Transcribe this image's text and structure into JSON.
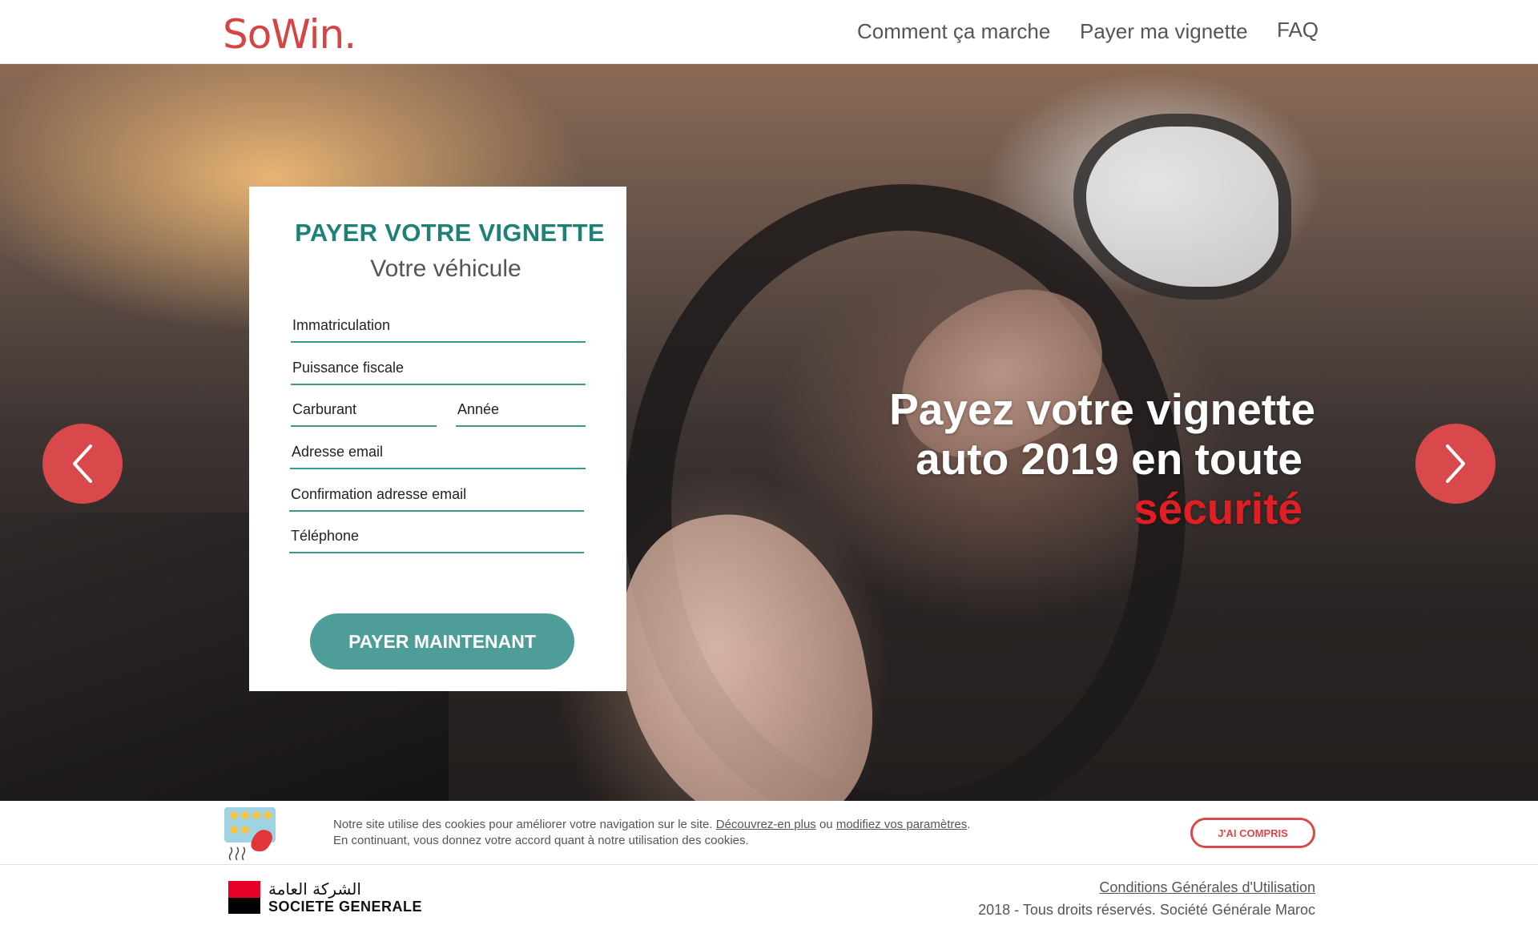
{
  "brand": {
    "logo": "SoWin."
  },
  "nav": {
    "items": [
      "Comment ça marche",
      "Payer ma vignette",
      "FAQ"
    ]
  },
  "form": {
    "title": "PAYER VOTRE VIGNETTE",
    "subtitle": "Votre véhicule",
    "fields": {
      "immatriculation": "Immatriculation",
      "puissance": "Puissance fiscale",
      "carburant": "Carburant",
      "annee": "Année",
      "email": "Adresse email",
      "email_confirm": "Confirmation adresse email",
      "telephone": "Téléphone"
    },
    "submit_label": "PAYER MAINTENANT"
  },
  "hero": {
    "line1": "Payez votre vignette",
    "line2": "auto 2019 en toute",
    "highlight": "sécurité"
  },
  "cookie": {
    "text_start": "Notre site utilise des cookies pour améliorer votre navigation sur le site.",
    "link_more": "Découvrez-en plus",
    "text_or": "ou",
    "link_settings": "modifiez vos paramètres",
    "text_period": ".",
    "line2": "En continuant, vous donnez votre accord quant à notre utilisation des cookies.",
    "accept_label": "J'AI COMPRIS"
  },
  "footer": {
    "company_arabic": "الشركة العامة",
    "company_name": "SOCIETE GENERALE",
    "terms_link": "Conditions Générales d'Utilisation",
    "copyright": "2018 - Tous droits réservés. Société Générale Maroc"
  },
  "colors": {
    "brand_red": "#d64545",
    "accent_teal": "#1f8078",
    "button_teal": "#4f9d98",
    "arrow_red": "#d9484a",
    "highlight_red": "#e01f25"
  },
  "icons": {
    "prev": "chevron-left-icon",
    "next": "chevron-right-icon",
    "cookie": "cookie-tray-icon"
  }
}
